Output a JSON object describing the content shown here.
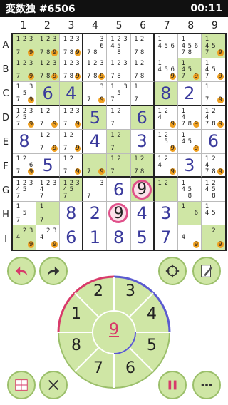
{
  "status": {
    "title": "変数独 #6506",
    "time": "00:11"
  },
  "columns": [
    "1",
    "2",
    "3",
    "4",
    "5",
    "6",
    "7",
    "8",
    "9"
  ],
  "rows": [
    "A",
    "B",
    "C",
    "D",
    "E",
    "F",
    "G",
    "H",
    "I"
  ],
  "board": [
    [
      {
        "c": [
          "1",
          "2",
          "3",
          "",
          "",
          "",
          "7",
          "",
          "9"
        ],
        "g": 1
      },
      {
        "c": [
          "1",
          "2",
          "3",
          "",
          "",
          "",
          "7",
          "8",
          "9"
        ],
        "g": 1
      },
      {
        "c": [
          "1",
          "2",
          "3",
          "",
          "",
          "",
          "7",
          "8",
          "9"
        ]
      },
      {
        "c": [
          "",
          "",
          "3",
          "",
          "",
          "6",
          "7",
          "8",
          ""
        ]
      },
      {
        "c": [
          "1",
          "2",
          "3",
          "4",
          "5",
          "",
          "",
          "8",
          ""
        ]
      },
      {
        "c": [
          "1",
          "2",
          "",
          "",
          "",
          "",
          "7",
          "8",
          ""
        ]
      },
      {
        "c": [
          "1",
          "",
          "",
          "4",
          "5",
          "6",
          "",
          "",
          ""
        ]
      },
      {
        "c": [
          "1",
          "",
          "",
          "4",
          "5",
          "6",
          "7",
          "8",
          ""
        ]
      },
      {
        "c": [
          "1",
          "",
          "",
          "4",
          "5",
          "",
          "7",
          "",
          "9"
        ],
        "g": 1
      }
    ],
    [
      {
        "c": [
          "1",
          "2",
          "3",
          "",
          "",
          "",
          "7",
          "",
          "9"
        ],
        "g": 1
      },
      {
        "c": [
          "1",
          "2",
          "3",
          "",
          "",
          "",
          "7",
          "8",
          "9"
        ],
        "g": 1
      },
      {
        "c": [
          "1",
          "2",
          "3",
          "",
          "",
          "",
          "7",
          "8",
          "9"
        ]
      },
      {
        "c": [
          "1",
          "2",
          "3",
          "",
          "",
          "",
          "7",
          "8",
          "9"
        ]
      },
      {
        "c": [
          "1",
          "2",
          "3",
          "",
          "",
          "",
          "7",
          "8",
          ""
        ]
      },
      {
        "c": [
          "1",
          "2",
          "",
          "",
          "",
          "",
          "7",
          "8",
          ""
        ]
      },
      {
        "c": [
          "1",
          "",
          "",
          "4",
          "5",
          "6",
          "",
          "",
          "9"
        ]
      },
      {
        "c": [
          "1",
          "",
          "",
          "4",
          "5",
          "",
          "7",
          "",
          "9"
        ],
        "g": 1
      },
      {
        "c": [
          "1",
          "",
          "",
          "4",
          "5",
          "",
          "7",
          "",
          "9"
        ]
      }
    ],
    [
      {
        "c": [
          "1",
          "",
          "3",
          "",
          "5",
          "",
          "7",
          "",
          "9"
        ]
      },
      {
        "v": "6",
        "g": 1
      },
      {
        "v": "4",
        "g": 1
      },
      {
        "c": [
          "",
          "",
          "3",
          "",
          "",
          "",
          "7",
          "",
          "9"
        ]
      },
      {
        "c": [
          "1",
          "",
          "3",
          "",
          "5",
          "",
          "7",
          "",
          ""
        ]
      },
      {
        "c": [
          "1",
          "",
          "",
          "",
          "",
          "",
          "7",
          "",
          ""
        ]
      },
      {
        "v": "8",
        "g": 1
      },
      {
        "v": "2"
      },
      {
        "c": [
          "1",
          "",
          "",
          "",
          "",
          "",
          "7",
          "",
          "9"
        ]
      }
    ],
    [
      {
        "c": [
          "1",
          "2",
          "3",
          "4",
          "5",
          "",
          "7",
          "",
          "9"
        ]
      },
      {
        "c": [
          "1",
          "2",
          "",
          "",
          "",
          "",
          "7",
          "",
          "9"
        ]
      },
      {
        "c": [
          "1",
          "2",
          "3",
          "",
          "",
          "",
          "7",
          "",
          "9"
        ]
      },
      {
        "v": "5",
        "g": 1
      },
      {
        "c": [
          "1",
          "2",
          "",
          "",
          "",
          "",
          "7",
          "",
          ""
        ]
      },
      {
        "v": "6",
        "g": 1
      },
      {
        "c": [
          "1",
          "2",
          "",
          "4",
          "",
          "",
          "",
          "",
          "9"
        ]
      },
      {
        "c": [
          "1",
          "",
          "",
          "4",
          "",
          "",
          "7",
          "8",
          "9"
        ]
      },
      {
        "c": [
          "1",
          "2",
          "",
          "4",
          "",
          "",
          "7",
          "8",
          "9"
        ]
      }
    ],
    [
      {
        "v": "8"
      },
      {
        "c": [
          "1",
          "2",
          "",
          "",
          "",
          "",
          "7",
          "",
          "9"
        ]
      },
      {
        "c": [
          "1",
          "2",
          "",
          "",
          "",
          "",
          "7",
          "",
          "9"
        ]
      },
      {
        "v": "4"
      },
      {
        "c": [
          "1",
          "2",
          "",
          "",
          "",
          "",
          "7",
          "",
          ""
        ],
        "g": 1
      },
      {
        "v": "3"
      },
      {
        "c": [
          "1",
          "2",
          "",
          "",
          "5",
          "",
          "",
          "",
          "9"
        ]
      },
      {
        "c": [
          "1",
          "",
          "",
          "4",
          "5",
          "",
          "",
          "",
          "9"
        ]
      },
      {
        "v": "6"
      }
    ],
    [
      {
        "c": [
          "1",
          "2",
          "",
          "",
          "",
          "6",
          "7",
          "",
          "9"
        ]
      },
      {
        "v": "5"
      },
      {
        "c": [
          "1",
          "2",
          "",
          "",
          "",
          "",
          "7",
          "",
          "9"
        ]
      },
      {
        "c": [
          "",
          "",
          "",
          "",
          "",
          "",
          "7",
          "",
          "9"
        ],
        "g": 1
      },
      {
        "c": [
          "1",
          "2",
          "",
          "",
          "",
          "",
          "7",
          "",
          ""
        ],
        "g": 1
      },
      {
        "c": [
          "1",
          "2",
          "",
          "",
          "",
          "",
          "7",
          "8",
          ""
        ],
        "g": 1
      },
      {
        "c": [
          "1",
          "2",
          "",
          "4",
          "",
          "",
          "",
          "",
          "9"
        ]
      },
      {
        "v": "3"
      },
      {
        "c": [
          "1",
          "2",
          "",
          "4",
          "",
          "",
          "7",
          "8",
          "9"
        ]
      }
    ],
    [
      {
        "c": [
          "1",
          "2",
          "3",
          "4",
          "5",
          "",
          "7",
          "",
          ""
        ]
      },
      {
        "c": [
          "1",
          "2",
          "3",
          "4",
          "",
          "",
          "7",
          "",
          ""
        ]
      },
      {
        "c": [
          "1",
          "2",
          "3",
          "4",
          "5",
          "",
          "7",
          "",
          ""
        ],
        "g": 1
      },
      {
        "c": [
          "",
          "",
          "3",
          "",
          "",
          "",
          "7",
          "",
          ""
        ]
      },
      {
        "v": "6"
      },
      {
        "ring": "9",
        "g": 1
      },
      {
        "c": [
          "1",
          "2",
          "",
          "",
          "",
          "",
          "",
          "",
          ""
        ],
        "g": 1
      },
      {
        "c": [
          "1",
          "",
          "",
          "4",
          "5",
          "",
          "",
          "8",
          ""
        ]
      },
      {
        "c": [
          "1",
          "2",
          "",
          "4",
          "5",
          "",
          "",
          "8",
          ""
        ]
      }
    ],
    [
      {
        "c": [
          "1",
          "",
          "",
          "",
          "5",
          "",
          "7",
          "",
          ""
        ]
      },
      {
        "c": [
          "1",
          "",
          "",
          "",
          "",
          "",
          "7",
          "",
          ""
        ],
        "g": 1
      },
      {
        "v": "8"
      },
      {
        "v": "2"
      },
      {
        "ring": "9"
      },
      {
        "v": "4"
      },
      {
        "v": "3"
      },
      {
        "c": [
          "1",
          "",
          "",
          "",
          "",
          "6",
          "",
          "",
          ""
        ],
        "g": 1
      },
      {
        "c": [
          "1",
          "",
          "",
          "4",
          "5",
          "",
          "",
          "",
          ""
        ]
      }
    ],
    [
      {
        "c": [
          "",
          "2",
          "3",
          "4",
          "",
          "",
          "",
          "",
          "9"
        ],
        "g": 1
      },
      {
        "c": [
          "",
          "2",
          "3",
          "4",
          "",
          "",
          "",
          "",
          "9"
        ]
      },
      {
        "v": "6"
      },
      {
        "v": "1"
      },
      {
        "v": "8"
      },
      {
        "v": "5"
      },
      {
        "v": "7"
      },
      {
        "c": [
          "",
          "",
          "",
          "4",
          "",
          "",
          "",
          "",
          "9"
        ]
      },
      {
        "c": [
          "",
          "2",
          "",
          "",
          "",
          "",
          "",
          "",
          "9"
        ],
        "g": 1
      }
    ]
  ],
  "highlight_digit": "9",
  "wheel": {
    "digits": [
      "2",
      "3",
      "4",
      "5",
      "6",
      "7",
      "8",
      "1"
    ],
    "center": "9"
  },
  "colors": {
    "accent_green": "#cfe6a5",
    "highlight_pink": "#e0508a",
    "digit_blue": "#3a3a9c"
  }
}
